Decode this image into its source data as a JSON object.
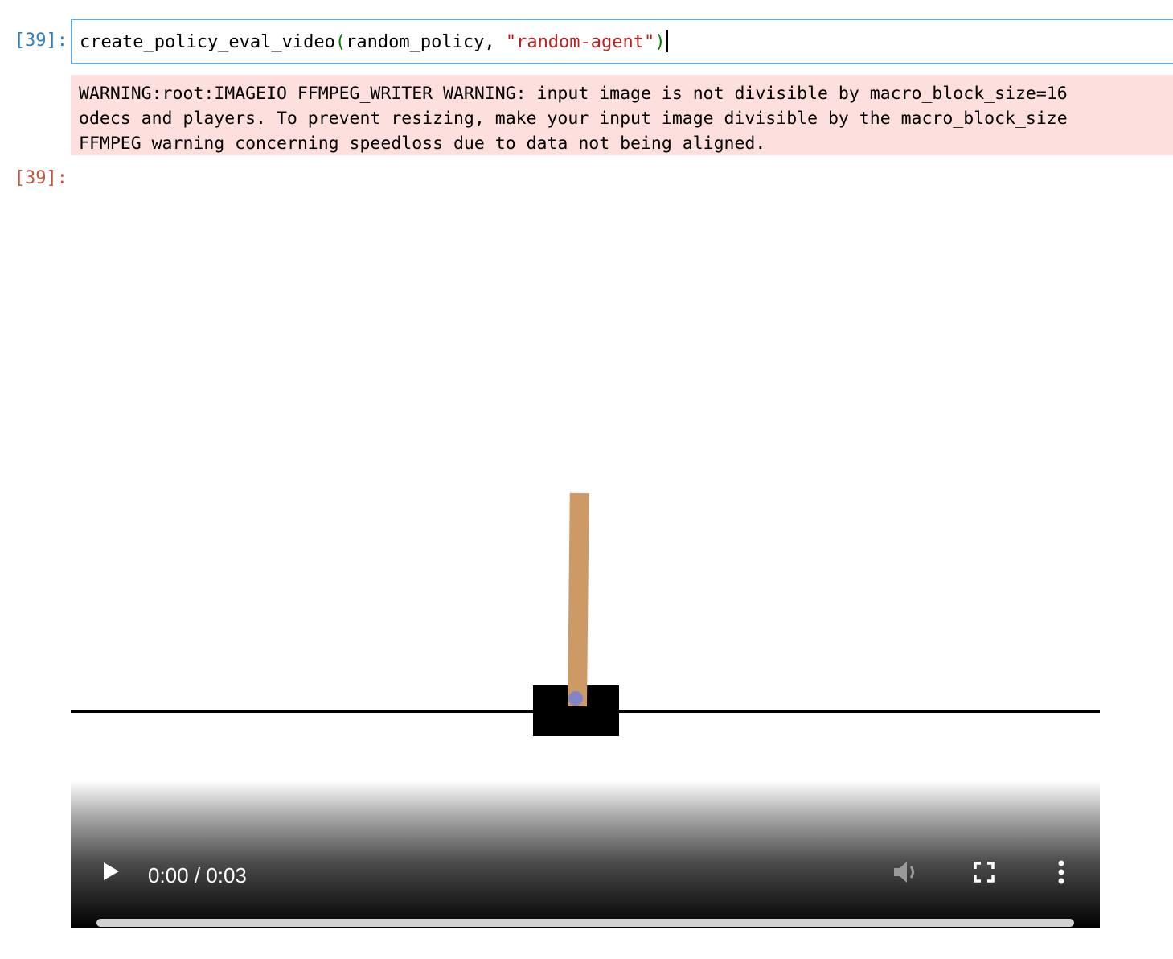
{
  "cell": {
    "input_prompt": "[39]:",
    "output_prompt": "[39]:",
    "code": {
      "func": "create_policy_eval_video",
      "open_paren": "(",
      "arg1": "random_policy, ",
      "arg2": "\"random-agent\"",
      "close_paren": ")"
    }
  },
  "stderr": {
    "lines": [
      "WARNING:root:IMAGEIO FFMPEG_WRITER WARNING: input image is not divisible by macro_block_size=16",
      "odecs and players. To prevent resizing, make your input image divisible by the macro_block_size",
      "FFMPEG warning concerning speedloss due to data not being aligned."
    ]
  },
  "video": {
    "time_display": "0:00 / 0:03",
    "progress": 0.0,
    "icons": {
      "play": "play-icon",
      "volume": "volume-icon",
      "fullscreen": "fullscreen-icon",
      "more": "more-options-icon"
    },
    "colors": {
      "pole": "#cd9a66",
      "cart": "#000000",
      "axle": "#8384ca",
      "track": "#000000"
    }
  },
  "colors": {
    "input_prompt": "#307fc1",
    "output_prompt": "#bf5b3d",
    "cell_border": "#66a8e0",
    "stderr_bg": "#fddfdd",
    "string": "#ba2121",
    "paren": "#008000"
  }
}
